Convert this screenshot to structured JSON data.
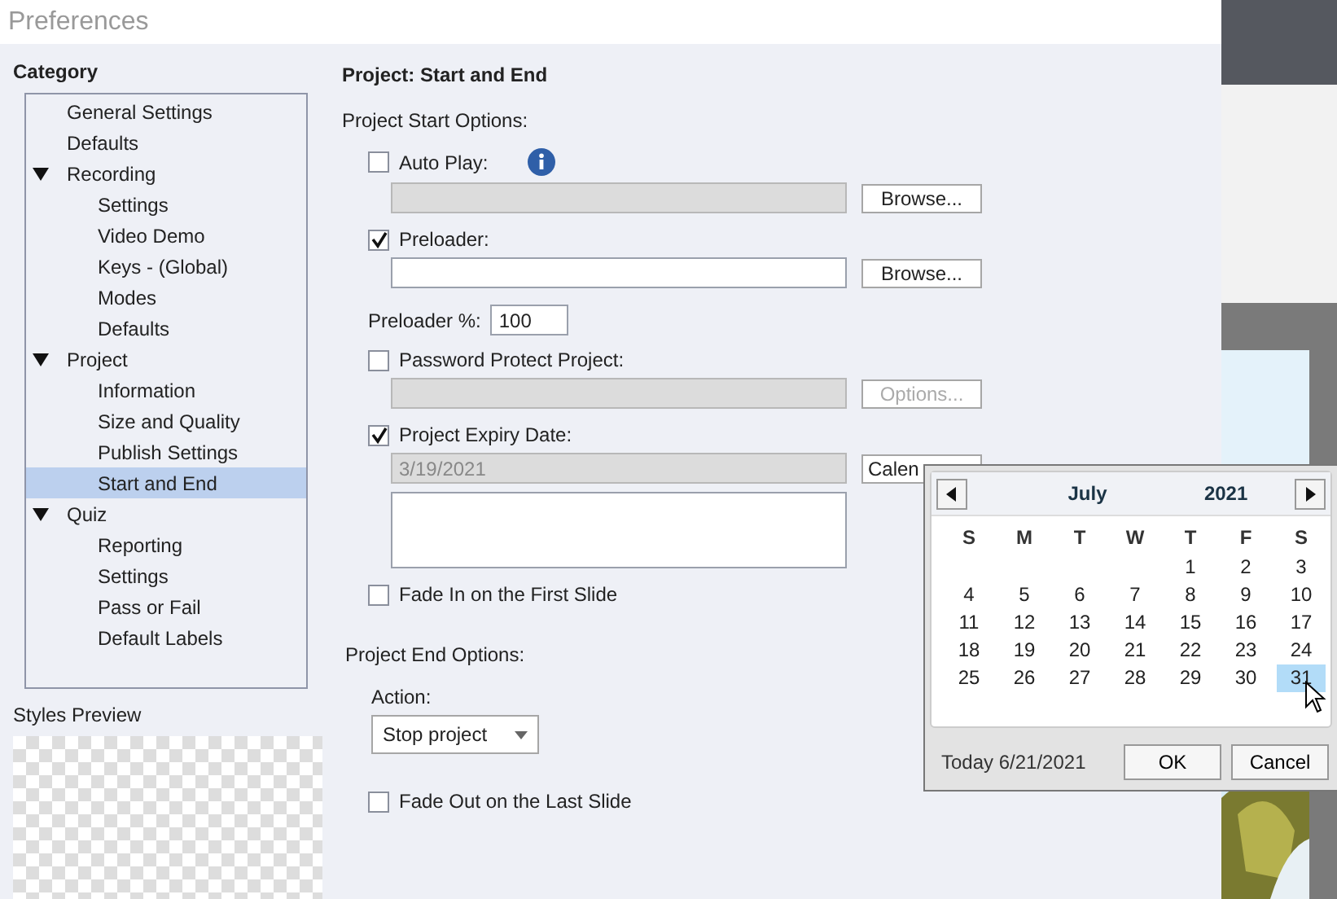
{
  "window": {
    "title": "Preferences"
  },
  "sidebar": {
    "heading": "Category",
    "items": [
      {
        "label": "General Settings",
        "selected": false
      },
      {
        "label": "Defaults",
        "selected": false
      },
      {
        "label": "Recording",
        "selected": false,
        "expanded": true,
        "children": [
          {
            "label": "Settings",
            "selected": false
          },
          {
            "label": "Video Demo",
            "selected": false
          },
          {
            "label": "Keys - (Global)",
            "selected": false
          },
          {
            "label": "Modes",
            "selected": false
          },
          {
            "label": "Defaults",
            "selected": false
          }
        ]
      },
      {
        "label": "Project",
        "selected": false,
        "expanded": true,
        "children": [
          {
            "label": "Information",
            "selected": false
          },
          {
            "label": "Size and Quality",
            "selected": false
          },
          {
            "label": "Publish Settings",
            "selected": false
          },
          {
            "label": "Start and End",
            "selected": true
          }
        ]
      },
      {
        "label": "Quiz",
        "selected": false,
        "expanded": true,
        "children": [
          {
            "label": "Reporting",
            "selected": false
          },
          {
            "label": "Settings",
            "selected": false
          },
          {
            "label": "Pass or Fail",
            "selected": false
          },
          {
            "label": "Default Labels",
            "selected": false
          }
        ]
      }
    ],
    "preview_label": "Styles Preview"
  },
  "panel": {
    "title": "Project: Start and End",
    "start_heading": "Project Start Options:",
    "auto_play": {
      "label": "Auto Play:",
      "checked": false,
      "field_disabled": true,
      "button": "Browse...",
      "button_disabled": false
    },
    "preloader": {
      "label": "Preloader:",
      "checked": true,
      "field_disabled": false,
      "button": "Browse...",
      "button_disabled": false
    },
    "preloader_percent": {
      "label": "Preloader %:",
      "value": "100"
    },
    "password": {
      "label": "Password Protect Project:",
      "checked": false,
      "field_disabled": true,
      "button": "Options...",
      "button_disabled": true
    },
    "expiry": {
      "label": "Project Expiry Date:",
      "checked": true,
      "value": "3/19/2021",
      "field_disabled": true,
      "button": "Calen",
      "button_disabled": false
    },
    "fade_in": {
      "label": "Fade In on the First Slide",
      "checked": false
    },
    "end_heading": "Project End Options:",
    "action": {
      "label": "Action:",
      "value": "Stop project"
    },
    "fade_out": {
      "label": "Fade Out on the Last Slide",
      "checked": false
    }
  },
  "calendar": {
    "month": "July",
    "year": "2021",
    "weekdays": [
      "S",
      "M",
      "T",
      "W",
      "T",
      "F",
      "S"
    ],
    "weeks": [
      [
        {
          "label": "1",
          "selected": false
        },
        {
          "label": "2",
          "selected": false
        },
        {
          "label": "3",
          "selected": false
        }
      ],
      [
        {
          "label": "4",
          "selected": false
        },
        {
          "label": "5",
          "selected": false
        },
        {
          "label": "6",
          "selected": false
        },
        {
          "label": "7",
          "selected": false
        },
        {
          "label": "8",
          "selected": false
        },
        {
          "label": "9",
          "selected": false
        },
        {
          "label": "10",
          "selected": false
        }
      ],
      [
        {
          "label": "11",
          "selected": false
        },
        {
          "label": "12",
          "selected": false
        },
        {
          "label": "13",
          "selected": false
        },
        {
          "label": "14",
          "selected": false
        },
        {
          "label": "15",
          "selected": false
        },
        {
          "label": "16",
          "selected": false
        },
        {
          "label": "17",
          "selected": false
        }
      ],
      [
        {
          "label": "18",
          "selected": false
        },
        {
          "label": "19",
          "selected": false
        },
        {
          "label": "20",
          "selected": false
        },
        {
          "label": "21",
          "selected": false
        },
        {
          "label": "22",
          "selected": false
        },
        {
          "label": "23",
          "selected": false
        },
        {
          "label": "24",
          "selected": false
        }
      ],
      [
        {
          "label": "25",
          "selected": false
        },
        {
          "label": "26",
          "selected": false
        },
        {
          "label": "27",
          "selected": false
        },
        {
          "label": "28",
          "selected": false
        },
        {
          "label": "29",
          "selected": false
        },
        {
          "label": "30",
          "selected": false
        },
        {
          "label": "31",
          "selected": true
        }
      ]
    ],
    "today": "Today 6/21/2021",
    "buttons": [
      "OK",
      "Cancel"
    ]
  }
}
